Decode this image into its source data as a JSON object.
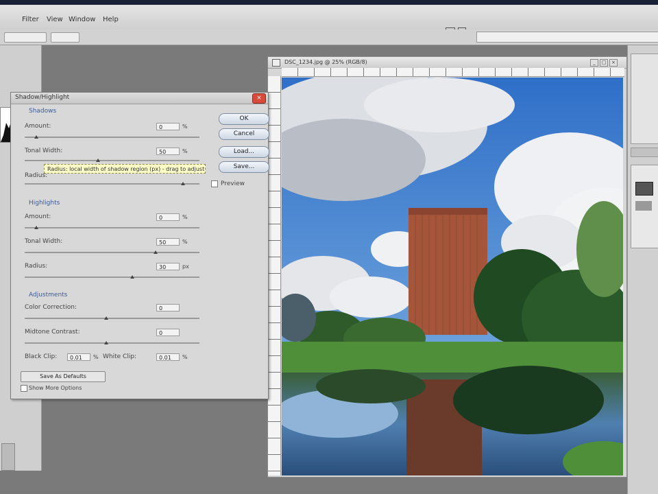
{
  "menubar": {
    "items": [
      "Filter",
      "View",
      "Window",
      "Help"
    ]
  },
  "image_window": {
    "title": "DSC_1234.jpg @ 25% (RGB/8)"
  },
  "dialog": {
    "title": "Shadow/Highlight",
    "shadows": {
      "section_label": "Shadows",
      "amount_label": "Amount:",
      "amount_value": "0",
      "amount_unit": "%",
      "tonal_width_label": "Tonal Width:",
      "tonal_width_value": "50",
      "tonal_width_unit": "%",
      "radius_label": "Radius:",
      "tooltip": "Radius: local width of shadow region (px) - drag to adjust"
    },
    "highlights": {
      "section_label": "Highlights",
      "amount_label": "Amount:",
      "amount_value": "0",
      "amount_unit": "%",
      "tonal_width_label": "Tonal Width:",
      "tonal_width_value": "50",
      "tonal_width_unit": "%",
      "radius_label": "Radius:",
      "radius_value": "30",
      "radius_unit": "px"
    },
    "adjustments": {
      "section_label": "Adjustments",
      "color_correction_label": "Color Correction:",
      "color_correction_value": "0",
      "midtone_contrast_label": "Midtone Contrast:",
      "midtone_contrast_value": "0",
      "black_clip_label": "Black Clip:",
      "black_clip_value": "0.01",
      "black_clip_unit": "%",
      "white_clip_label": "White Clip:",
      "white_clip_value": "0.01",
      "white_clip_unit": "%"
    },
    "buttons": {
      "ok": "OK",
      "cancel": "Cancel",
      "load": "Load...",
      "save": "Save..."
    },
    "preview_label": "Preview",
    "save_defaults_label": "Save As Defaults",
    "show_more_label": "Show More Options"
  },
  "colors": {
    "accent": "#3a5a9a",
    "close_button": "#d84a3a",
    "sky": "#3f7fd0",
    "building": "#a4553a"
  }
}
